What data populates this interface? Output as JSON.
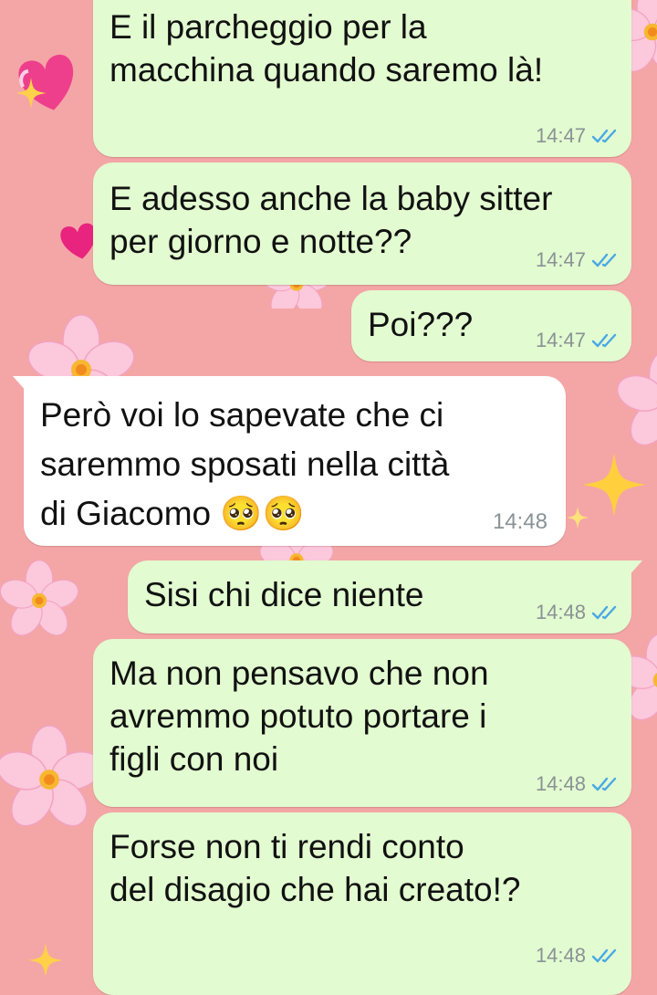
{
  "theme": {
    "wallpaper_color": "#f4a6a6",
    "outgoing_bubble_color": "#e2fbd0",
    "incoming_bubble_color": "#ffffff",
    "read_ticks_color": "#4aa8e6"
  },
  "messages": [
    {
      "direction": "outgoing",
      "text": "E il parcheggio per la\nmacchina quando saremo là!",
      "time": "14:47",
      "status": "read"
    },
    {
      "direction": "outgoing",
      "text": "E adesso anche la baby sitter\nper giorno e notte??",
      "time": "14:47",
      "status": "read"
    },
    {
      "direction": "outgoing",
      "text": "Poi???",
      "time": "14:47",
      "status": "read"
    },
    {
      "direction": "incoming",
      "text": "Però voi lo sapevate che ci\nsaremmo sposati nella città\ndi Giacomo 🥺🥺",
      "time": "14:48"
    },
    {
      "direction": "outgoing",
      "text": "Sisi chi dice niente",
      "time": "14:48",
      "status": "read"
    },
    {
      "direction": "outgoing",
      "text": "Ma non pensavo che non\navremmo potuto portare i\nfigli con noi",
      "time": "14:48",
      "status": "read"
    },
    {
      "direction": "outgoing",
      "text": "Forse non ti rendi conto\ndel disagio che hai creato!?",
      "time": "14:48",
      "status": "read"
    }
  ]
}
